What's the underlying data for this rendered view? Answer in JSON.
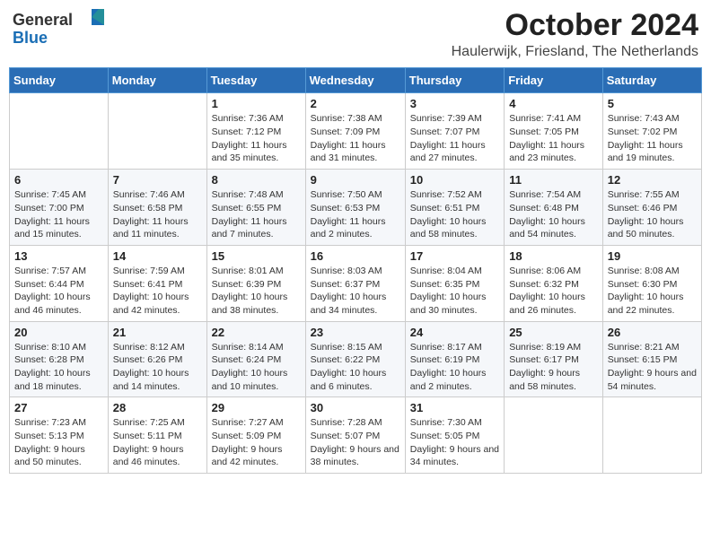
{
  "header": {
    "logo_general": "General",
    "logo_blue": "Blue",
    "month": "October 2024",
    "location": "Haulerwijk, Friesland, The Netherlands"
  },
  "weekdays": [
    "Sunday",
    "Monday",
    "Tuesday",
    "Wednesday",
    "Thursday",
    "Friday",
    "Saturday"
  ],
  "weeks": [
    [
      {
        "day": "",
        "info": ""
      },
      {
        "day": "",
        "info": ""
      },
      {
        "day": "1",
        "info": "Sunrise: 7:36 AM\nSunset: 7:12 PM\nDaylight: 11 hours and 35 minutes."
      },
      {
        "day": "2",
        "info": "Sunrise: 7:38 AM\nSunset: 7:09 PM\nDaylight: 11 hours and 31 minutes."
      },
      {
        "day": "3",
        "info": "Sunrise: 7:39 AM\nSunset: 7:07 PM\nDaylight: 11 hours and 27 minutes."
      },
      {
        "day": "4",
        "info": "Sunrise: 7:41 AM\nSunset: 7:05 PM\nDaylight: 11 hours and 23 minutes."
      },
      {
        "day": "5",
        "info": "Sunrise: 7:43 AM\nSunset: 7:02 PM\nDaylight: 11 hours and 19 minutes."
      }
    ],
    [
      {
        "day": "6",
        "info": "Sunrise: 7:45 AM\nSunset: 7:00 PM\nDaylight: 11 hours and 15 minutes."
      },
      {
        "day": "7",
        "info": "Sunrise: 7:46 AM\nSunset: 6:58 PM\nDaylight: 11 hours and 11 minutes."
      },
      {
        "day": "8",
        "info": "Sunrise: 7:48 AM\nSunset: 6:55 PM\nDaylight: 11 hours and 7 minutes."
      },
      {
        "day": "9",
        "info": "Sunrise: 7:50 AM\nSunset: 6:53 PM\nDaylight: 11 hours and 2 minutes."
      },
      {
        "day": "10",
        "info": "Sunrise: 7:52 AM\nSunset: 6:51 PM\nDaylight: 10 hours and 58 minutes."
      },
      {
        "day": "11",
        "info": "Sunrise: 7:54 AM\nSunset: 6:48 PM\nDaylight: 10 hours and 54 minutes."
      },
      {
        "day": "12",
        "info": "Sunrise: 7:55 AM\nSunset: 6:46 PM\nDaylight: 10 hours and 50 minutes."
      }
    ],
    [
      {
        "day": "13",
        "info": "Sunrise: 7:57 AM\nSunset: 6:44 PM\nDaylight: 10 hours and 46 minutes."
      },
      {
        "day": "14",
        "info": "Sunrise: 7:59 AM\nSunset: 6:41 PM\nDaylight: 10 hours and 42 minutes."
      },
      {
        "day": "15",
        "info": "Sunrise: 8:01 AM\nSunset: 6:39 PM\nDaylight: 10 hours and 38 minutes."
      },
      {
        "day": "16",
        "info": "Sunrise: 8:03 AM\nSunset: 6:37 PM\nDaylight: 10 hours and 34 minutes."
      },
      {
        "day": "17",
        "info": "Sunrise: 8:04 AM\nSunset: 6:35 PM\nDaylight: 10 hours and 30 minutes."
      },
      {
        "day": "18",
        "info": "Sunrise: 8:06 AM\nSunset: 6:32 PM\nDaylight: 10 hours and 26 minutes."
      },
      {
        "day": "19",
        "info": "Sunrise: 8:08 AM\nSunset: 6:30 PM\nDaylight: 10 hours and 22 minutes."
      }
    ],
    [
      {
        "day": "20",
        "info": "Sunrise: 8:10 AM\nSunset: 6:28 PM\nDaylight: 10 hours and 18 minutes."
      },
      {
        "day": "21",
        "info": "Sunrise: 8:12 AM\nSunset: 6:26 PM\nDaylight: 10 hours and 14 minutes."
      },
      {
        "day": "22",
        "info": "Sunrise: 8:14 AM\nSunset: 6:24 PM\nDaylight: 10 hours and 10 minutes."
      },
      {
        "day": "23",
        "info": "Sunrise: 8:15 AM\nSunset: 6:22 PM\nDaylight: 10 hours and 6 minutes."
      },
      {
        "day": "24",
        "info": "Sunrise: 8:17 AM\nSunset: 6:19 PM\nDaylight: 10 hours and 2 minutes."
      },
      {
        "day": "25",
        "info": "Sunrise: 8:19 AM\nSunset: 6:17 PM\nDaylight: 9 hours and 58 minutes."
      },
      {
        "day": "26",
        "info": "Sunrise: 8:21 AM\nSunset: 6:15 PM\nDaylight: 9 hours and 54 minutes."
      }
    ],
    [
      {
        "day": "27",
        "info": "Sunrise: 7:23 AM\nSunset: 5:13 PM\nDaylight: 9 hours and 50 minutes."
      },
      {
        "day": "28",
        "info": "Sunrise: 7:25 AM\nSunset: 5:11 PM\nDaylight: 9 hours and 46 minutes."
      },
      {
        "day": "29",
        "info": "Sunrise: 7:27 AM\nSunset: 5:09 PM\nDaylight: 9 hours and 42 minutes."
      },
      {
        "day": "30",
        "info": "Sunrise: 7:28 AM\nSunset: 5:07 PM\nDaylight: 9 hours and 38 minutes."
      },
      {
        "day": "31",
        "info": "Sunrise: 7:30 AM\nSunset: 5:05 PM\nDaylight: 9 hours and 34 minutes."
      },
      {
        "day": "",
        "info": ""
      },
      {
        "day": "",
        "info": ""
      }
    ]
  ]
}
